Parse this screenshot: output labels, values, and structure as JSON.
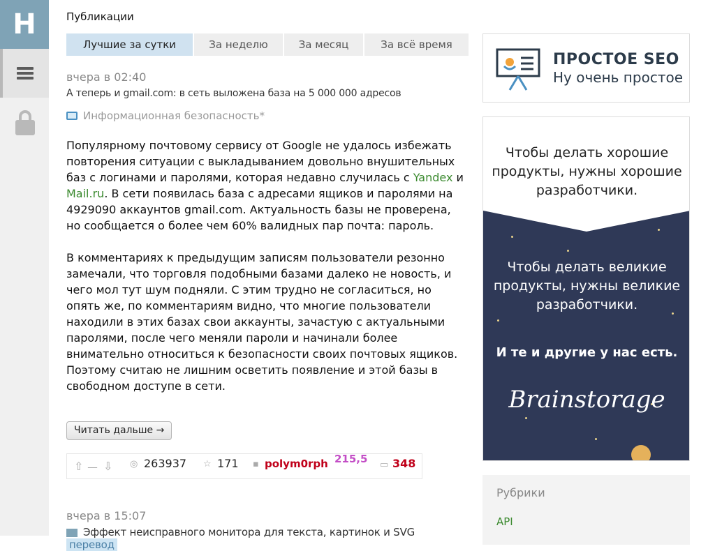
{
  "rail": {
    "logo": "H"
  },
  "section": {
    "title": "Публикации"
  },
  "tabs": [
    {
      "label": "Лучшие за сутки",
      "active": true
    },
    {
      "label": "За неделю",
      "active": false
    },
    {
      "label": "За месяц",
      "active": false
    },
    {
      "label": "За всё время",
      "active": false
    }
  ],
  "post1": {
    "date": "вчера в 02:40",
    "title": "А теперь и gmail.com: в сеть выложена база на 5 000 000 адресов",
    "hub": "Информационная безопасность*",
    "p1_a": "Популярному почтовому сервису от Google не удалось избежать повторения ситуации с выкладыванием довольно внушительных баз с логинами и паролями, которая недавно случилась с ",
    "link_yandex": "Yandex",
    "p1_b": " и ",
    "link_mail": "Mail.ru",
    "p1_c": ". В сети появилась база с адресами ящиков и паролями на 4929090 аккаунтов gmail.com. Актуальность базы не проверена, но сообщается о более чем 60% валидных пар почта: пароль.",
    "p2": "В комментариях к предыдущим записям пользователи резонно замечали, что торговля подобными базами далеко не новость, и чего мол тут шум подняли. С этим трудно не согласиться, но опять же, по комментариям видно, что многие пользователи находили в этих базах свои аккаунты, зачастую с актуальными паролями, после чего меняли пароли и начинали более внимательно относиться к безопасности своих почтовых ящиков. Поэтому считаю не лишним осветить появление и этой базы в свободном доступе в сети.",
    "read_more": "Читать дальше →",
    "vote_up": "⇧",
    "vote_score": "__",
    "vote_down": "⇩",
    "views": "263937",
    "favorites": "171",
    "author": "polym0rph",
    "karma": "215,5",
    "comments": "348"
  },
  "post2": {
    "date": "вчера в 15:07",
    "title": "Эффект неисправного монитора для текста, картинок и SVG",
    "badge": "перевод"
  },
  "sidebar": {
    "seo_title": "ПРОСТОЕ SEO",
    "seo_sub": "Ну очень простое",
    "ad_line1": "Чтобы делать хорошие продукты, нужны хорошие разработчики.",
    "ad_line2": "Чтобы делать великие продукты, нужны великие разработчики.",
    "ad_line3": "И те и другие у нас есть.",
    "ad_brand": "Brainstorage",
    "rubric_title": "Рубрики",
    "rubric_item": "API"
  }
}
